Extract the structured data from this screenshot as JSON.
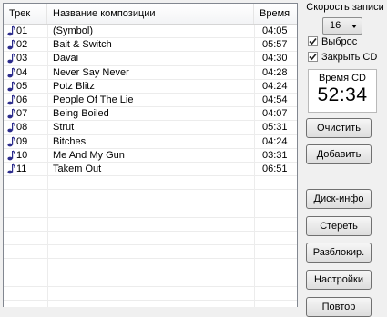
{
  "table": {
    "headers": {
      "track": "Трек",
      "title": "Название композиции",
      "time": "Время"
    },
    "rows": [
      {
        "num": "01",
        "title": "(Symbol)",
        "time": "04:05"
      },
      {
        "num": "02",
        "title": "Bait & Switch",
        "time": "05:57"
      },
      {
        "num": "03",
        "title": "Davai",
        "time": "04:30"
      },
      {
        "num": "04",
        "title": "Never Say Never",
        "time": "04:28"
      },
      {
        "num": "05",
        "title": "Potz Blitz",
        "time": "04:24"
      },
      {
        "num": "06",
        "title": "People Of The Lie",
        "time": "04:54"
      },
      {
        "num": "07",
        "title": "Being Boiled",
        "time": "04:07"
      },
      {
        "num": "08",
        "title": "Strut",
        "time": "05:31"
      },
      {
        "num": "09",
        "title": "Bitches",
        "time": "04:24"
      },
      {
        "num": "10",
        "title": "Me And My Gun",
        "time": "03:31"
      },
      {
        "num": "11",
        "title": "Takem Out",
        "time": "06:51"
      }
    ],
    "empty_rows": 9
  },
  "side": {
    "speed_label": "Скорость записи",
    "speed_value": "16",
    "eject_label": "Выброс",
    "eject_checked": true,
    "close_cd_label": "Закрыть CD",
    "close_cd_checked": true,
    "cd_time_label": "Время CD",
    "cd_time_value": "52:34",
    "buttons": {
      "clear": "Очистить",
      "add": "Добавить",
      "disc_info": "Диск-инфо",
      "erase": "Стереть",
      "unlock": "Разблокир.",
      "settings": "Настройки",
      "last": "Повтор"
    }
  },
  "colors": {
    "note_icon": "#2b2b8c",
    "window_bg": "#f0f0f0"
  }
}
